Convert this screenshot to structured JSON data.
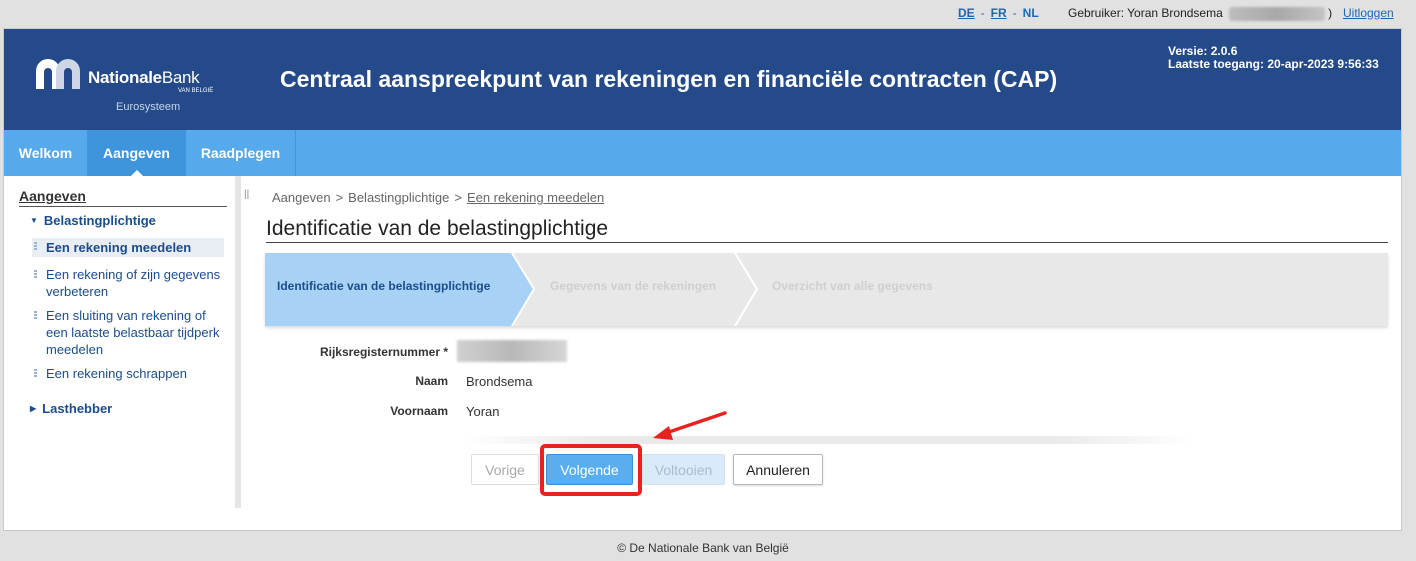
{
  "topbar": {
    "languages": [
      "DE",
      "FR",
      "NL"
    ],
    "user_label": "Gebruiker: Yoran Brondsema",
    "user_suffix": ")",
    "logout": "Uitloggen"
  },
  "header": {
    "logo_brand_1": "Nationale",
    "logo_brand_2": "Bank",
    "logo_country": "VAN BELGIË",
    "logo_sub": "Eurosysteem",
    "title": "Centraal aanspreekpunt van rekeningen en financiële contracten (CAP)",
    "version": "Versie: 2.0.6",
    "last_access": "Laatste toegang: 20-apr-2023 9:56:33"
  },
  "nav": {
    "tabs": [
      {
        "label": "Welkom",
        "active": false
      },
      {
        "label": "Aangeven",
        "active": true
      },
      {
        "label": "Raadplegen",
        "active": false
      }
    ]
  },
  "sidebar": {
    "heading": "Aangeven",
    "group1": "Belastingplichtige",
    "items": [
      {
        "label": "Een rekening meedelen",
        "selected": true
      },
      {
        "label": "Een rekening of zijn gegevens verbeteren",
        "selected": false
      },
      {
        "label": "Een sluiting van rekening of een laatste belastbaar tijdperk meedelen",
        "selected": false
      },
      {
        "label": "Een rekening schrappen",
        "selected": false
      }
    ],
    "group2": "Lasthebber",
    "splitter": "||"
  },
  "breadcrumb": {
    "items": [
      "Aangeven",
      "Belastingplichtige",
      "Een rekening meedelen"
    ],
    "separator": ">"
  },
  "page": {
    "title": "Identificatie van de belastingplichtige"
  },
  "wizard": {
    "steps": [
      {
        "label": "Identificatie van de belastingplichtige",
        "active": true
      },
      {
        "label": "Gegevens van de rekeningen",
        "active": false
      },
      {
        "label": "Overzicht van alle gegevens",
        "active": false
      }
    ]
  },
  "form": {
    "rrn_label": "Rijksregisternummer *",
    "naam_label": "Naam",
    "naam_value": "Brondsema",
    "voornaam_label": "Voornaam",
    "voornaam_value": "Yoran"
  },
  "buttons": {
    "previous": "Vorige",
    "next": "Volgende",
    "finish": "Voltooien",
    "cancel": "Annuleren"
  },
  "footer": {
    "text": "© De Nationale Bank van België"
  },
  "colors": {
    "banner": "#244a8a",
    "nav": "#56a9ea",
    "active_step": "#a7d2f6",
    "highlight": "#e8231f"
  }
}
